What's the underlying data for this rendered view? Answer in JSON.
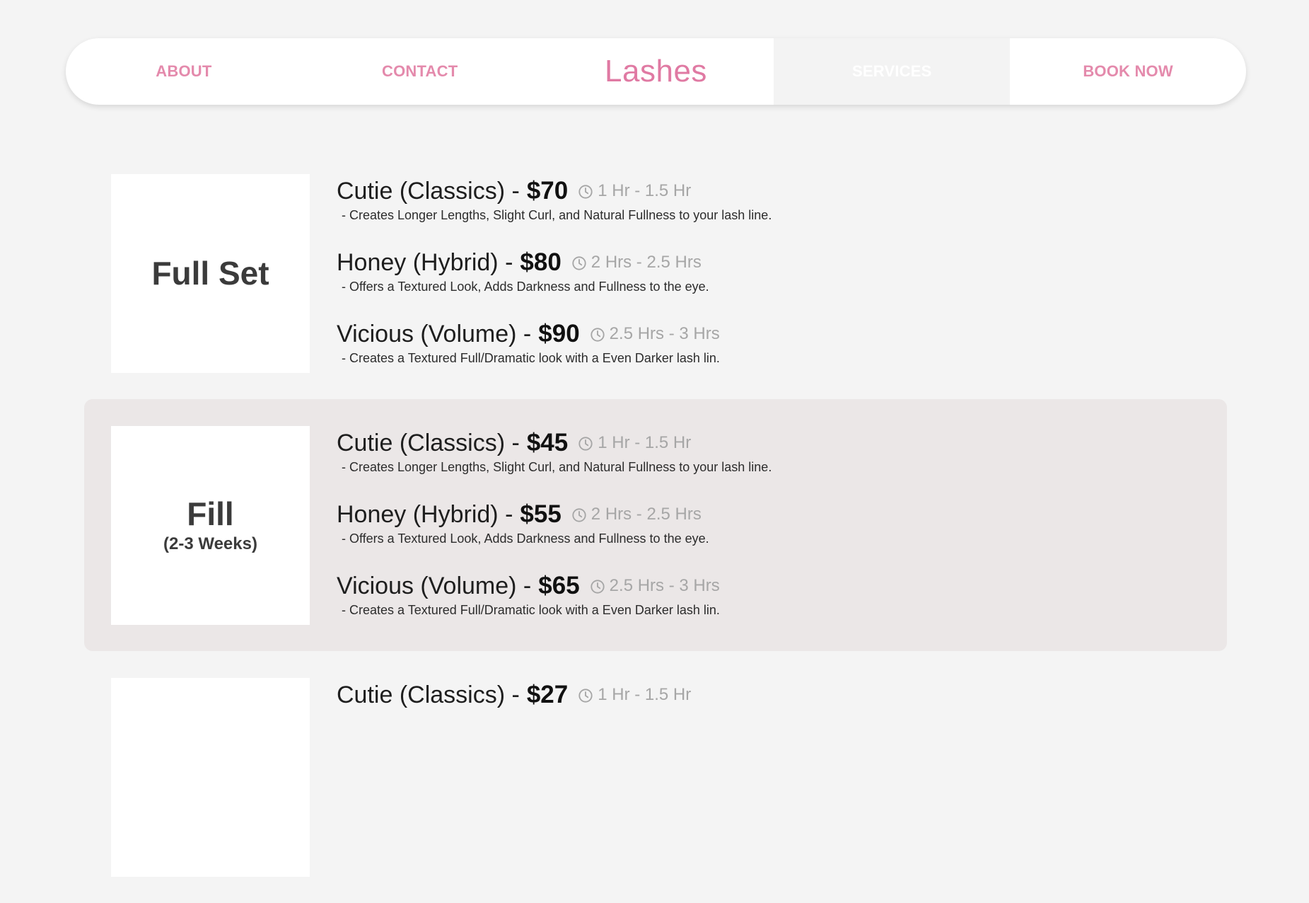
{
  "nav": {
    "about": "ABOUT",
    "contact": "CONTACT",
    "logo": "Lashes",
    "services": "SERVICES",
    "book": "BOOK NOW"
  },
  "sections": [
    {
      "title": "Full Set",
      "subtitle": "",
      "items": [
        {
          "name": "Cutie (Classics) -",
          "price": "$70",
          "time": "1 Hr - 1.5 Hr",
          "desc": "- Creates Longer Lengths, Slight Curl, and Natural Fullness to your lash line."
        },
        {
          "name": "Honey (Hybrid) -",
          "price": "$80",
          "time": "2 Hrs - 2.5 Hrs",
          "desc": "- Offers a Textured Look, Adds Darkness and Fullness to the eye."
        },
        {
          "name": "Vicious (Volume) -",
          "price": "$90",
          "time": "2.5 Hrs - 3 Hrs",
          "desc": "- Creates a Textured Full/Dramatic look with a Even Darker lash lin."
        }
      ]
    },
    {
      "title": "Fill",
      "subtitle": "(2-3 Weeks)",
      "items": [
        {
          "name": "Cutie (Classics) -",
          "price": "$45",
          "time": "1 Hr - 1.5 Hr",
          "desc": "- Creates Longer Lengths, Slight Curl, and Natural Fullness to your lash line."
        },
        {
          "name": "Honey (Hybrid) -",
          "price": "$55",
          "time": "2 Hrs - 2.5 Hrs",
          "desc": "- Offers a Textured Look, Adds Darkness and Fullness to the eye."
        },
        {
          "name": "Vicious (Volume) -",
          "price": "$65",
          "time": "2.5 Hrs - 3 Hrs",
          "desc": "- Creates a Textured Full/Dramatic look with a Even Darker lash lin."
        }
      ]
    },
    {
      "title": "",
      "subtitle": "",
      "items": [
        {
          "name": "Cutie (Classics) -",
          "price": "$27",
          "time": "1 Hr - 1.5 Hr",
          "desc": ""
        }
      ]
    }
  ],
  "colors": {
    "accent": "#e48aac",
    "shaded": "#ebe7e7",
    "background": "#f4f4f4"
  },
  "icons": {
    "time": "clock-icon"
  }
}
